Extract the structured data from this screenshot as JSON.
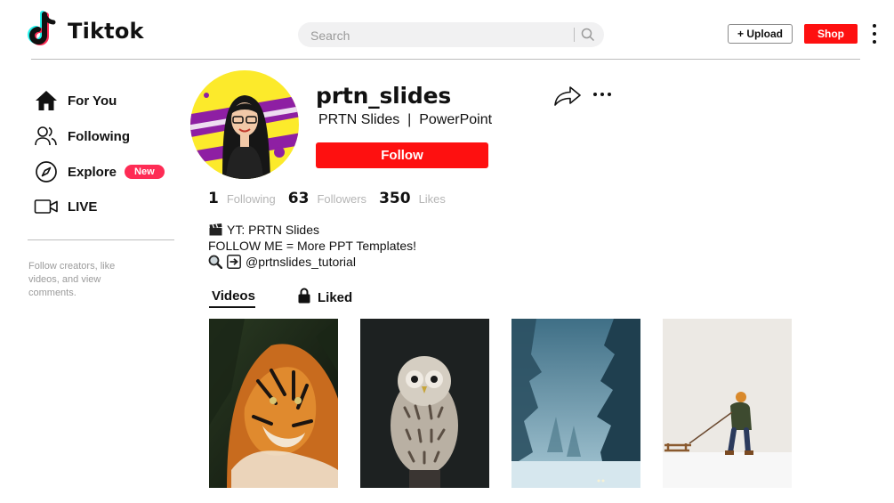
{
  "header": {
    "logo_text": "Tiktok",
    "search_placeholder": "Search",
    "upload_label": "+ Upload",
    "shop_label": "Shop"
  },
  "sidebar": {
    "items": [
      {
        "label": "For You",
        "icon": "home-icon"
      },
      {
        "label": "Following",
        "icon": "users-icon"
      },
      {
        "label": "Explore",
        "icon": "compass-icon",
        "badge": "New"
      },
      {
        "label": "LIVE",
        "icon": "video-camera-icon"
      }
    ],
    "note": "Follow creators, like videos, and view comments."
  },
  "profile": {
    "username": "prtn_slides",
    "display_name": "PRTN Slides  |  PowerPoint",
    "follow_label": "Follow",
    "stats": [
      {
        "value": "1",
        "label": "Following"
      },
      {
        "value": "63",
        "label": "Followers"
      },
      {
        "value": "350",
        "label": "Likes"
      }
    ],
    "bio": [
      "YT: PRTN Slides",
      "FOLLOW ME = More PPT Templates!",
      "@prtnslides_tutorial"
    ]
  },
  "tabs": {
    "videos": "Videos",
    "liked": "Liked"
  },
  "videos": [
    {
      "subject": "tiger"
    },
    {
      "subject": "owl"
    },
    {
      "subject": "misty forest"
    },
    {
      "subject": "child with sled in snow"
    }
  ],
  "colors": {
    "accent": "#fe1010",
    "badge": "#fe2c55",
    "muted_text": "#b5b5b5"
  }
}
